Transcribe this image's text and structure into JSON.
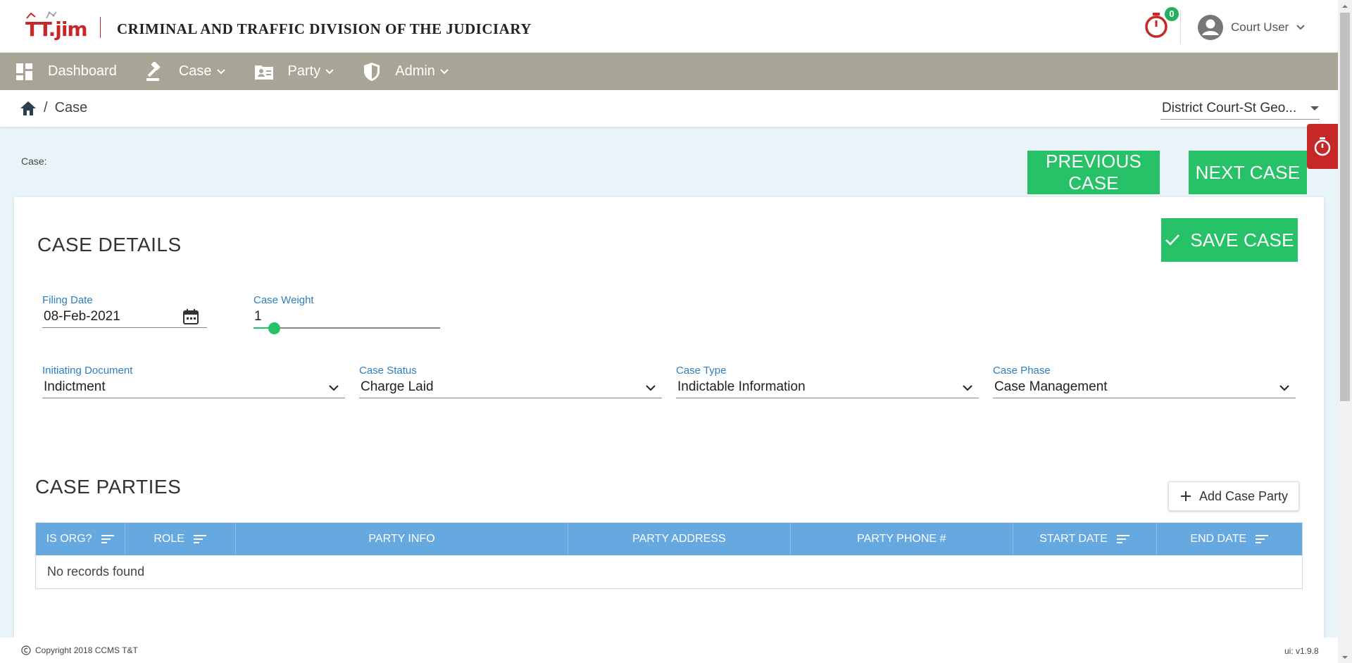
{
  "header": {
    "logo_text": "TT.jim",
    "app_title": "CRIMINAL AND TRAFFIC DIVISION OF THE JUDICIARY",
    "timer_count": "0",
    "user_name": "Court User"
  },
  "nav": {
    "items": [
      {
        "label": "Dashboard",
        "icon": "dashboard-icon"
      },
      {
        "label": "Case",
        "icon": "gavel-icon"
      },
      {
        "label": "Party",
        "icon": "contact-card-icon"
      },
      {
        "label": "Admin",
        "icon": "shield-icon"
      }
    ]
  },
  "breadcrumb": {
    "separator": "/",
    "current": "Case"
  },
  "court_select": {
    "value": "District Court-St Geo..."
  },
  "case_bar": {
    "case_label": "Case:",
    "previous_label": "PREVIOUS CASE",
    "next_label": "NEXT CASE"
  },
  "case_details": {
    "title": "CASE DETAILS",
    "save_label": "SAVE CASE",
    "filing_date": {
      "label": "Filing Date",
      "value": "08-Feb-2021"
    },
    "case_weight": {
      "label": "Case Weight",
      "value": "1",
      "fraction": 0.0
    },
    "initiating_document": {
      "label": "Initiating Document",
      "value": "Indictment"
    },
    "case_status": {
      "label": "Case Status",
      "value": "Charge Laid"
    },
    "case_type": {
      "label": "Case Type",
      "value": "Indictable Information"
    },
    "case_phase": {
      "label": "Case Phase",
      "value": "Case Management"
    }
  },
  "case_parties": {
    "title": "CASE PARTIES",
    "add_label": "Add Case Party",
    "columns": [
      {
        "label": "IS ORG?",
        "sortable": true
      },
      {
        "label": "ROLE",
        "sortable": true
      },
      {
        "label": "PARTY INFO",
        "sortable": false
      },
      {
        "label": "PARTY ADDRESS",
        "sortable": false
      },
      {
        "label": "PARTY PHONE #",
        "sortable": false
      },
      {
        "label": "START DATE",
        "sortable": true
      },
      {
        "label": "END DATE",
        "sortable": true
      }
    ],
    "empty_text": "No records found"
  },
  "footer": {
    "copyright": "Copyright 2018  CCMS T&T",
    "version": "ui: v1.9.8"
  },
  "colors": {
    "primary_green": "#27c267",
    "nav_bg": "#a8a596",
    "table_header": "#66a8e0",
    "brand_red": "#c62828",
    "label_blue": "#2e7fc1"
  }
}
